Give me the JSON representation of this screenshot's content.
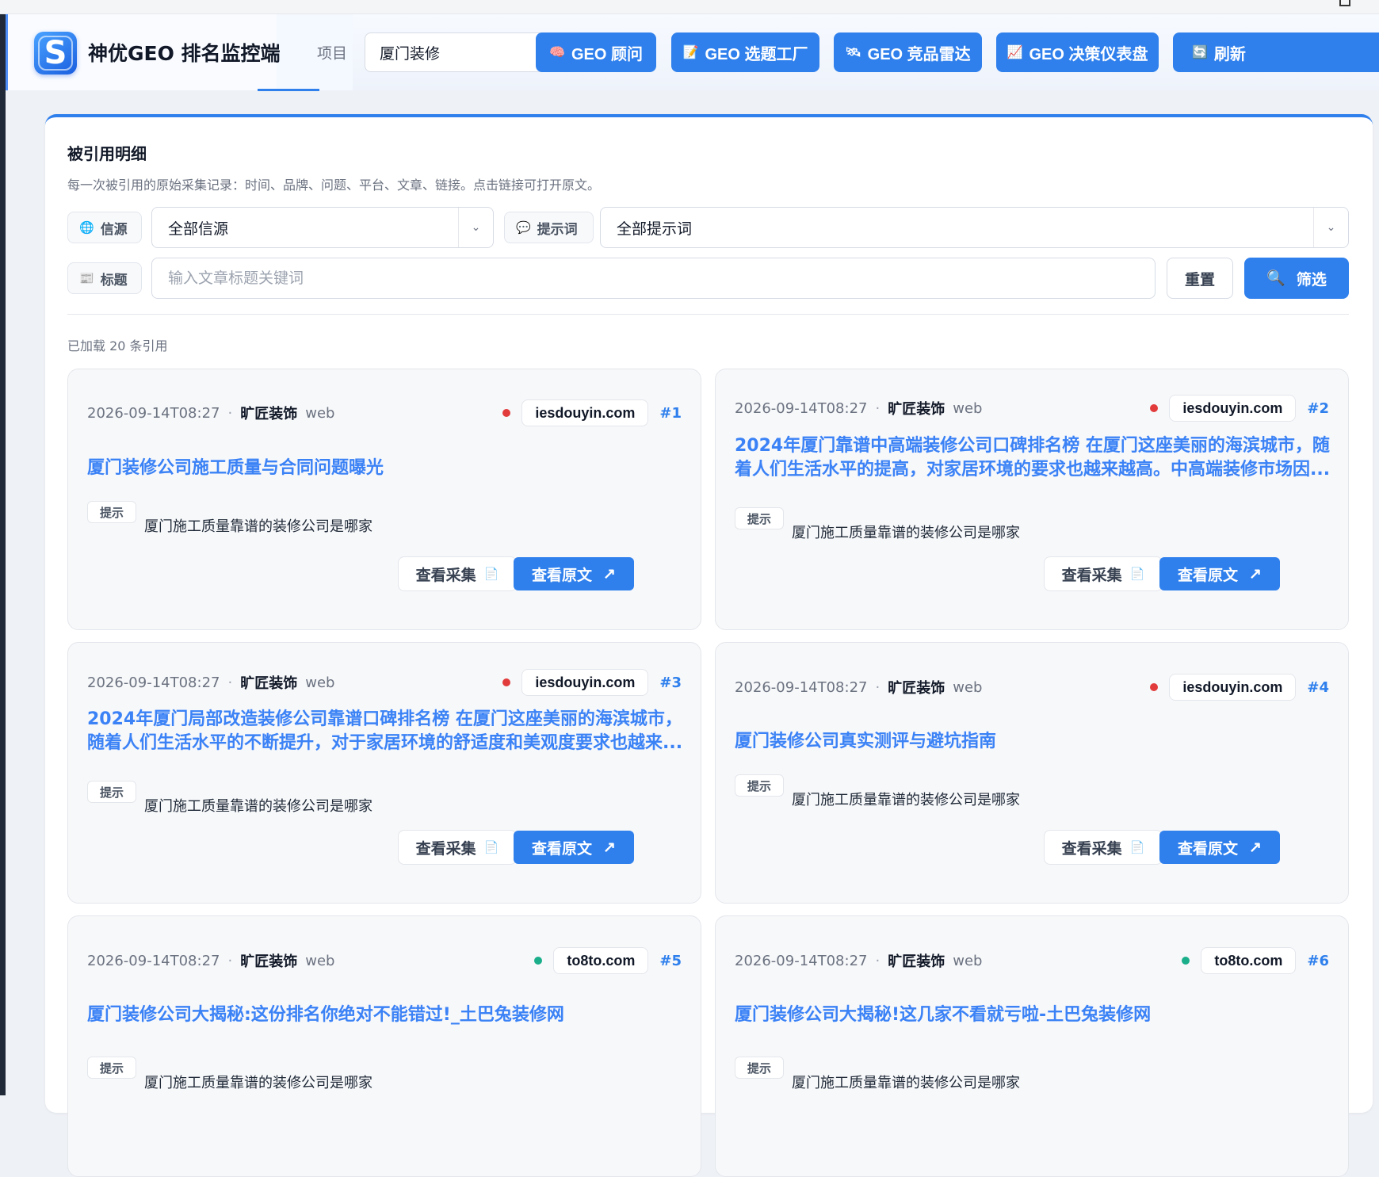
{
  "app": {
    "title": "神优GEO 排名监控端",
    "logo_letter": "S"
  },
  "header": {
    "project_label": "项目",
    "project_value": "厦门装修",
    "buttons": [
      {
        "label": "GEO 顾问",
        "icon": "brain-icon",
        "glyph": "🧠"
      },
      {
        "label": "GEO 选题工厂",
        "icon": "document-icon",
        "glyph": "📝"
      },
      {
        "label": "GEO 竞品雷达",
        "icon": "satellite-icon",
        "glyph": "🛰"
      },
      {
        "label": "GEO 决策仪表盘",
        "icon": "chart-icon",
        "glyph": "📈"
      },
      {
        "label": "刷新",
        "icon": "refresh-icon",
        "glyph": "🔄"
      }
    ]
  },
  "panel": {
    "title": "被引用明细",
    "description": "每一次被引用的原始采集记录：时间、品牌、问题、平台、文章、链接。点击链接可打开原文。",
    "filters": {
      "source_label": "信源",
      "source_value": "全部信源",
      "prompt_label": "提示词",
      "prompt_value": "全部提示词",
      "title_label": "标题",
      "title_placeholder": "输入文章标题关键词",
      "reset_label": "重置",
      "filter_label": "筛选"
    },
    "loaded_text": "已加载 20 条引用"
  },
  "card_labels": {
    "hint": "提示",
    "view": "查看采集",
    "open": "查看原文"
  },
  "colors": {
    "accent": "#2f80ed",
    "dot_red": "#e23b3b",
    "dot_green": "#1aae8a"
  },
  "cards": [
    {
      "time": "2026-09-14T08:27",
      "brand": "旷匠装饰",
      "platform": "web",
      "site": "iesdouyin.com",
      "dot": "red",
      "num": "#1",
      "title": "厦门装修公司施工质量与合同问题曝光",
      "prompt": "厦门施工质量靠谱的装修公司是哪家"
    },
    {
      "time": "2026-09-14T08:27",
      "brand": "旷匠装饰",
      "platform": "web",
      "site": "iesdouyin.com",
      "dot": "red",
      "num": "#2",
      "title": "2024年厦门靠谱中高端装修公司口碑排名榜 在厦门这座美丽的海滨城市，随着人们生活水平的提高，对家居环境的要求也越来越高。中高端装修市场因...",
      "prompt": "厦门施工质量靠谱的装修公司是哪家"
    },
    {
      "time": "2026-09-14T08:27",
      "brand": "旷匠装饰",
      "platform": "web",
      "site": "iesdouyin.com",
      "dot": "red",
      "num": "#3",
      "title": "2024年厦门局部改造装修公司靠谱口碑排名榜 在厦门这座美丽的海滨城市，随着人们生活水平的不断提升，对于家居环境的舒适度和美观度要求也越来...",
      "prompt": "厦门施工质量靠谱的装修公司是哪家"
    },
    {
      "time": "2026-09-14T08:27",
      "brand": "旷匠装饰",
      "platform": "web",
      "site": "iesdouyin.com",
      "dot": "red",
      "num": "#4",
      "title": "厦门装修公司真实测评与避坑指南",
      "prompt": "厦门施工质量靠谱的装修公司是哪家"
    },
    {
      "time": "2026-09-14T08:27",
      "brand": "旷匠装饰",
      "platform": "web",
      "site": "to8to.com",
      "dot": "green",
      "num": "#5",
      "title": "厦门装修公司大揭秘:这份排名你绝对不能错过!_土巴兔装修网",
      "prompt": "厦门施工质量靠谱的装修公司是哪家"
    },
    {
      "time": "2026-09-14T08:27",
      "brand": "旷匠装饰",
      "platform": "web",
      "site": "to8to.com",
      "dot": "green",
      "num": "#6",
      "title": "厦门装修公司大揭秘!这几家不看就亏啦-土巴兔装修网",
      "prompt": "厦门施工质量靠谱的装修公司是哪家"
    }
  ]
}
